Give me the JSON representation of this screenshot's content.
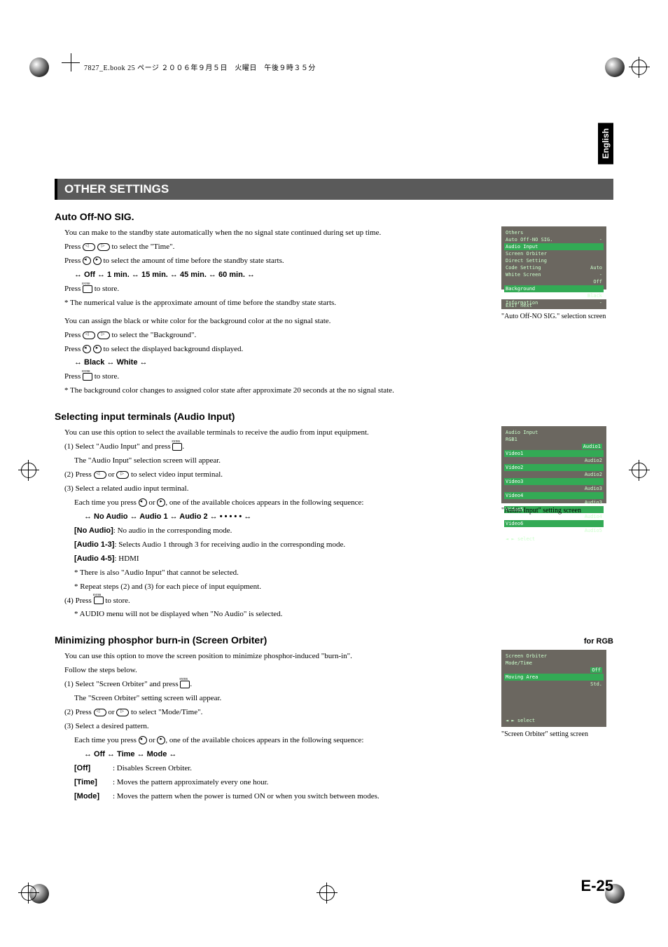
{
  "print_header": "7827_E.book  25 ページ  ２００６年９月５日　火曜日　午後９時３５分",
  "side_tab": "English",
  "bar_title": "OTHER SETTINGS",
  "page_number": "E-25",
  "sec1": {
    "title": "Auto Off-NO SIG.",
    "p1": "You can make to the standby state automatically when the no signal state continued during set up time.",
    "p2a": "Press ",
    "p2b": " to select the \"Time\".",
    "p3a": "Press ",
    "p3b": " to select the amount of time before the standby state starts.",
    "p4": "↔ Off ↔ 1 min. ↔ 15 min. ↔ 45 min. ↔ 60 min. ↔",
    "p5a": "Press ",
    "p5b": " to store.",
    "p6": "* The numerical value is the approximate amount of time before the standby state starts.",
    "p7": "You can assign the black or white color for the background color at the no signal state.",
    "p8a": "Press ",
    "p8b": " to select the \"Background\".",
    "p9a": "Press ",
    "p9b": " to select the displayed background displayed.",
    "p10": "↔ Black ↔ White ↔",
    "p11a": "Press ",
    "p11b": " to store.",
    "p12": "* The background color changes to assigned color state after approximate 20 seconds at the no signal state.",
    "osd_title": "Others",
    "osd_rows": [
      {
        "l": "Auto Off-NO SIG.",
        "v": "-"
      },
      {
        "l": "Audio Input",
        "v": ""
      },
      {
        "l": "Screen Orbiter",
        "v": ""
      },
      {
        "l": "Direct Setting",
        "v": ""
      },
      {
        "l": "Code Setting",
        "v": "Auto"
      },
      {
        "l": "White Screen",
        "v": "-"
      },
      {
        "l": "",
        "v": "Off"
      },
      {
        "l": "Background",
        "v": ""
      },
      {
        "l": "",
        "v": "Black"
      },
      {
        "l": "Information",
        "v": "-"
      }
    ],
    "osd_bottom": "EXIT  next",
    "caption": "\"Auto Off-NO SIG.\" selection screen"
  },
  "sec2": {
    "title": "Selecting input terminals (Audio Input)",
    "p1": "You can use this option to select the available terminals to receive the audio from input equipment.",
    "p2a": "(1) Select \"Audio Input\" and press ",
    "p2b": ".",
    "p3": "The \"Audio Input\" selection screen will appear.",
    "p4a": "(2) Press ",
    "p4b": " or ",
    "p4c": " to select video input terminal.",
    "p5": "(3) Select a related audio input terminal.",
    "p6a": "Each time you press ",
    "p6b": " or ",
    "p6c": ", one of the available choices appears in the following sequence:",
    "p7": "↔ No Audio ↔ Audio 1 ↔ Audio 2 ↔ • • • • • ↔",
    "p8l": "[No Audio]",
    "p8t": ": No audio in the corresponding mode.",
    "p9l": "[Audio 1-3]",
    "p9t": ": Selects Audio 1 through 3 for receiving audio in the corresponding mode.",
    "p10l": "[Audio 4-5]",
    "p10t": ": HDMI",
    "p11": "* There is also \"Audio Input\" that cannot be selected.",
    "p12": "* Repeat steps (2) and (3) for each piece of input equipment.",
    "p13a": "(4) Press ",
    "p13b": " to store.",
    "p14": "* AUDIO menu will not be displayed when \"No Audio\" is selected.",
    "osd_title": "Audio Input",
    "osd_sub": "RGB1",
    "osd_rows": [
      {
        "l": "",
        "v": "Audio1"
      },
      {
        "l": "Video1",
        "v": ""
      },
      {
        "l": "",
        "v": "Audio2"
      },
      {
        "l": "Video2",
        "v": ""
      },
      {
        "l": "",
        "v": "Audio2"
      },
      {
        "l": "Video3",
        "v": ""
      },
      {
        "l": "",
        "v": "Audio3"
      },
      {
        "l": "Video4",
        "v": ""
      },
      {
        "l": "",
        "v": "Audio3"
      },
      {
        "l": "Video5",
        "v": ""
      },
      {
        "l": "",
        "v": "Audio4"
      },
      {
        "l": "Video6",
        "v": ""
      },
      {
        "l": "",
        "v": "Audio5"
      }
    ],
    "osd_bottom": "◄ ►  select",
    "caption": "\"Audio Input\" setting screen"
  },
  "sec3": {
    "title": "Minimizing phosphor burn-in (Screen Orbiter)",
    "rtag": "for RGB",
    "p1": "You can use this option to move the screen position to minimize phosphor-induced \"burn-in\".",
    "p2": "Follow the steps below.",
    "p3a": "(1) Select \"Screen Orbiter\" and press ",
    "p3b": ".",
    "p4": "The \"Screen Orbiter\" setting screen will appear.",
    "p5a": "(2) Press ",
    "p5b": " or ",
    "p5c": " to select \"Mode/Time\".",
    "p6": "(3) Select a desired pattern.",
    "p7a": "Each time you press ",
    "p7b": " or ",
    "p7c": ", one of the available choices appears in the following sequence:",
    "p8": "↔ Off ↔ Time ↔ Mode ↔",
    "p9l": "[Off]",
    "p9t": ": Disables Screen Orbiter.",
    "p10l": "[Time]",
    "p10t": ": Moves the pattern approximately every one hour.",
    "p11l": "[Mode]",
    "p11t": ": Moves the pattern when the power is turned ON or when you switch between modes.",
    "osd_title": "Screen Orbiter",
    "osd_rows": [
      {
        "l": "Mode/Time",
        "v": ""
      },
      {
        "l": "",
        "v": "Off"
      },
      {
        "l": "Moving Area",
        "v": ""
      },
      {
        "l": "",
        "v": "Std."
      }
    ],
    "osd_bottom": "◄ ►  select",
    "caption": "\"Screen Orbiter\" setting screen"
  }
}
